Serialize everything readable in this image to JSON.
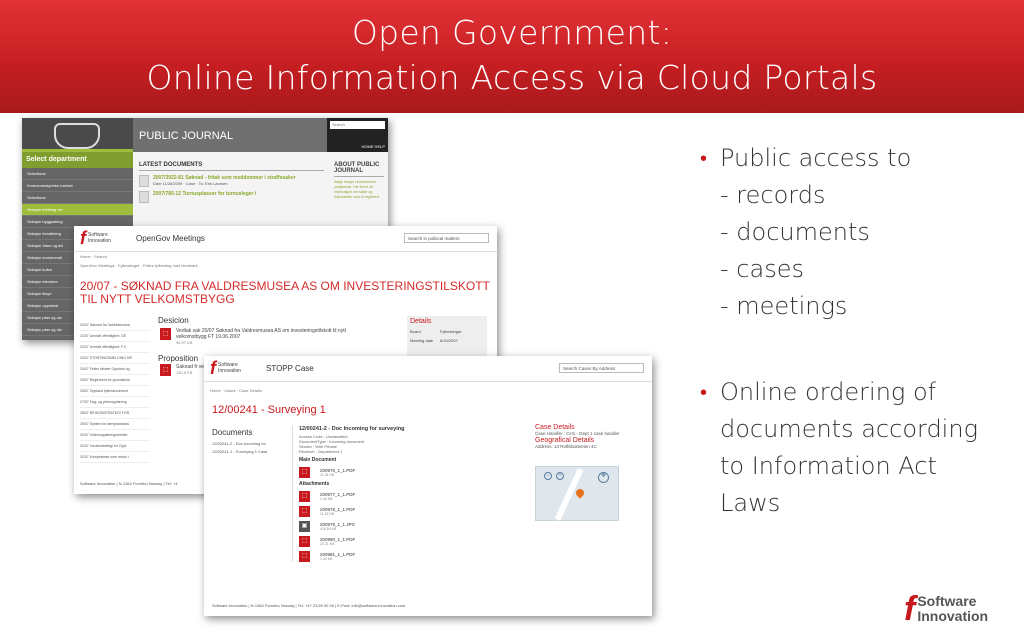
{
  "slide": {
    "title_line1": "Open Government:",
    "title_line2": "Online Information Access via Cloud Portals",
    "bullets": [
      {
        "lines": [
          "Public access to",
          "- records",
          "- documents",
          "- cases",
          "- meetings"
        ]
      },
      {
        "lines": [
          "Online ordering of",
          "documents according",
          "to Information Act",
          "Laws"
        ]
      }
    ],
    "logo": {
      "word1": "Software",
      "word2": "Innovation"
    },
    "accent_color": "#c8191e"
  },
  "public_journal": {
    "header": "PUBLIC JOURNAL",
    "search_placeholder": "Search",
    "nav": "HOME   HELP",
    "select_department": "Select department",
    "sidebar_rows": [
      "Selections",
      "Kommunestyrelse-merket",
      "Selections",
      "Seksjon kretsing vei",
      "Seksjon byggsaking",
      "Seksjon forvaltning",
      "Seksjon Vann og avl",
      "Seksjon kommunalt",
      "Seksjon kultur",
      "Seksjon eiendom",
      "Seksjon tilsyn",
      "Seksjon oppvekst",
      "Seksjon plan og utv",
      "Seksjon plan og utv"
    ],
    "latest_header": "LATEST DOCUMENTS",
    "latest_docs": [
      {
        "title": "2007/3922-81 Søknad - fritak som meddommer i straffesaker",
        "meta": "Date 11/26/2009 · Case · To: Erik Laursen"
      },
      {
        "title": "2007/785-12 Turnusplasser for turnusleger i",
        "meta": ""
      }
    ],
    "about_header": "ABOUT PUBLIC JOURNAL",
    "about_text": "Søkje innsyn i kommunens postjournal. Her finner du informasjon om saker og dokumenter som er registrert."
  },
  "meetings": {
    "app": "OpenGov Meetings",
    "search_placeholder": "Search in political matters",
    "breadcrumb1": "Home · Search",
    "breadcrumb2": "OpenGov Meetings · Fylkestinget · Felles fylkesting med Hedmark",
    "title": "20/07 - SØKNAD FRA VALDRESMUSEA AS OM INVESTERINGSTILSKOTT TIL NYTT VELKOMSTBYGG",
    "list": [
      "20/07 Søknad fra Valdresmusea",
      "21/07 Unntatt offentlighet: OE",
      "22/07 Unntatt offentlighet: F.C",
      "23/07 STORTINGSMELDING NR",
      "24/07 Felles fakster Oppland og",
      "25/07 Reglement for grunnskole",
      "26/07 Oppland fylkeskommune",
      "27/07 Fag- og yrkesopplæring",
      "28/07 REGIONSTRATEGI FOR",
      "29/07 System for læreplanklass",
      "30/07 Videreopplæringsmeldin",
      "31/07 Jordverstrategi for Oppl",
      "32/07 Kompetanse som motor i"
    ],
    "decision_header": "Desicion",
    "decision_text": "Vedtak sak 20/07 Søknad fra Valdresmusea AS om investeringstilskott til nytt velkomstbygg FT 19.06.2007",
    "decision_size": "96.97 KB",
    "proposition_header": "Proposition",
    "proposition_text": "Saknad fr velkomst",
    "proposition_size": "130.5 KB",
    "details_header": "Details",
    "details": [
      {
        "k": "Board",
        "v": "Fylkestinget"
      },
      {
        "k": "Meeting date",
        "v": "6/19/2007"
      }
    ],
    "footer": "Software Innovation | N-1364 Fornebu Norway | Tel: +4"
  },
  "case": {
    "app": "STOPP Case",
    "search_placeholder": "Search Cases By Address",
    "breadcrumb": "Home · Cases · Case Details",
    "title": "12/00241 - Surveying 1",
    "documents_header": "Documents",
    "documents": [
      "12/00241-2 - Doc Incoming for",
      "12/00241-1 - Surveying 1 Case"
    ],
    "doc_title": "12/00241-2 - Doc Incoming for surveying",
    "meta_lines": [
      "Access Code : Unclassified",
      "DocumentType : Incoming document",
      "Sender : With Private",
      "Reciever : Department 1"
    ],
    "main_doc_header": "Main Document",
    "main_doc": {
      "name": "200976_1_1.PDF",
      "size": "11.34 KB"
    },
    "attachments_header": "Attachments",
    "attachments": [
      {
        "name": "200977_1_1.PDF",
        "size": "1.44 KB"
      },
      {
        "name": "200978_1_1.PDF",
        "size": "11.43 KB"
      },
      {
        "name": "200979_1_1.JPG",
        "size": "416.54 KB"
      },
      {
        "name": "200980_1_1.PDF",
        "size": "22.21 KB"
      },
      {
        "name": "200981_1_1.PDF",
        "size": "1.44 KB"
      }
    ],
    "case_details_header": "Case Details",
    "case_handler": "Case Handler : CH1 - Dept 1 case handler",
    "geo_header": "Geografical Details",
    "address": "Address: 13 Rolfsbuktveien 4C",
    "footer": "Software Innovation | N-1364 Fornebu Norway | Tel: +47 23 89 90 00 | E-Post: info@software-innovation.com"
  }
}
